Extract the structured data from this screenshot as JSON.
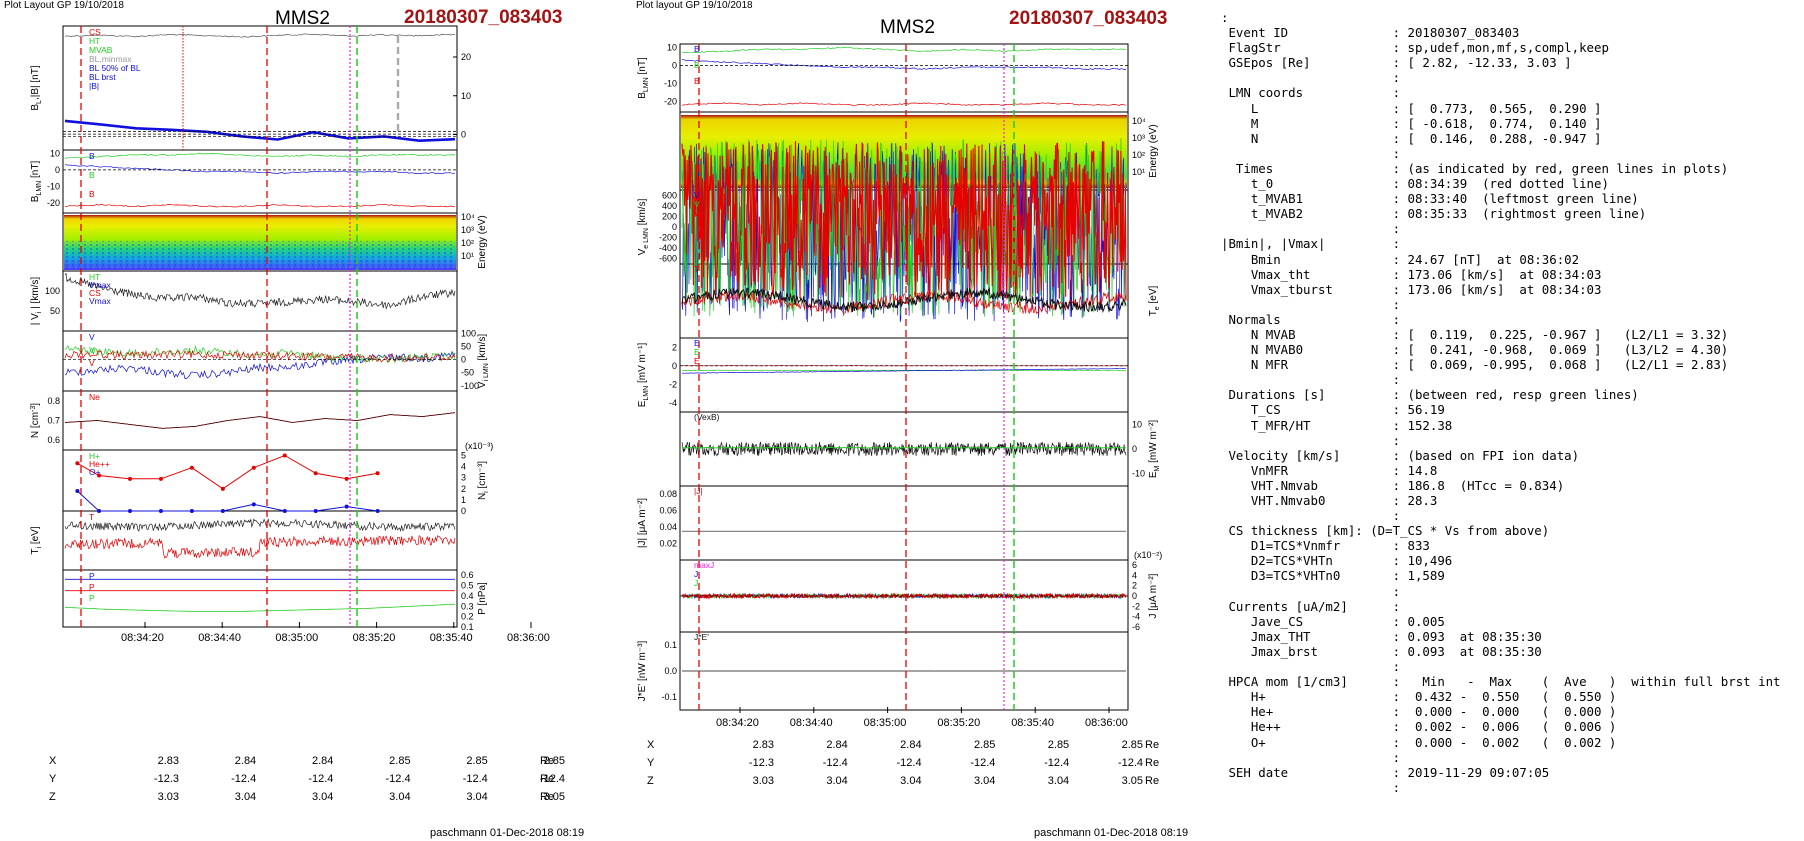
{
  "left_page": {
    "header": "Plot Layout GP 19/10/2018",
    "spacecraft": "MMS2",
    "event": "20180307_083403",
    "footer": "paschmann 01-Dec-2018 08:19",
    "panel_labels": [
      {
        "text": "B",
        "sub": "L",
        "tail": ",|B| [nT]"
      },
      {
        "text": "B",
        "sub": "LMN",
        "tail": " [nT]"
      },
      {
        "text": "Energy (eV)",
        "right": true
      },
      {
        "text": "| V",
        "sub": "i",
        "tail": " | [km/s]"
      },
      {
        "text": "V",
        "sub": "i LMN",
        "tail": " [km/s]",
        "right": true
      },
      {
        "text": "N [cm",
        "sup": "-3",
        "tail": "]"
      },
      {
        "text": "N",
        "sub": "i",
        "tail": " [cm⁻³]",
        "right": true
      },
      {
        "text": "T",
        "sub": "i",
        "tail": " [eV]"
      },
      {
        "text": "P [nPa]",
        "right": true
      }
    ],
    "legends": [
      [
        "CS",
        "HT",
        "MVAB",
        "BL,minmax",
        "BL 50% of BL",
        "BL brst",
        "|B|"
      ],
      [
        "B",
        "B",
        "B"
      ],
      [],
      [
        "HT",
        "Vmax",
        "CS",
        "Vmax"
      ],
      [
        "V",
        "V",
        "V"
      ],
      [
        "Ne"
      ],
      [
        "H+",
        "He++",
        "O+"
      ],
      [
        "T"
      ],
      [
        "P",
        "P",
        "P"
      ]
    ],
    "tick_labels": {
      "p0": [
        "20",
        "10",
        "0"
      ],
      "p1": [
        "10",
        "0",
        "-10",
        "-20"
      ],
      "p2": [
        "10⁴",
        "10³",
        "10²",
        "10¹"
      ],
      "p3": [
        "100",
        "50"
      ],
      "p4": [
        "100",
        "50",
        "0",
        "-50",
        "-100"
      ],
      "p5": [
        "0.8",
        "0.7",
        "0.6"
      ],
      "p6": [
        "5",
        "4",
        "3",
        "2",
        "1",
        "0"
      ],
      "p6_scale": "(x10⁻³)",
      "p8": [
        "0.6",
        "0.5",
        "0.4",
        "0.3",
        "0.2",
        "0.1"
      ]
    },
    "time_labels": [
      "08:34:20",
      "08:34:40",
      "08:35:00",
      "08:35:20",
      "08:35:40",
      "08:36:00"
    ],
    "position_rows": [
      {
        "name": "X",
        "values": [
          "2.83",
          "2.84",
          "2.84",
          "2.85",
          "2.85",
          "2.85"
        ],
        "unit": "Re"
      },
      {
        "name": "Y",
        "values": [
          "-12.3",
          "-12.4",
          "-12.4",
          "-12.4",
          "-12.4",
          "-12.4"
        ],
        "unit": "Re"
      },
      {
        "name": "Z",
        "values": [
          "3.03",
          "3.04",
          "3.04",
          "3.04",
          "3.04",
          "3.05"
        ],
        "unit": "Re"
      }
    ]
  },
  "right_page": {
    "header": "Plot layout GP 19/10/2018",
    "spacecraft": "MMS2",
    "event": "20180307_083403",
    "footer": "paschmann 01-Dec-2018 08:19",
    "panel_labels": [
      {
        "text": "B",
        "sub": "LMN",
        "tail": " [nT]"
      },
      {
        "text": "Energy (eV)",
        "right": true
      },
      {
        "text": "V",
        "sub": "e LMN",
        "tail": " [km/s]"
      },
      {
        "text": "T",
        "sub": "e",
        "tail": " [eV]",
        "right": true
      },
      {
        "text": "E",
        "sub": "LMN",
        "tail": " [mV m⁻¹]"
      },
      {
        "text": "E",
        "sub": "M",
        "tail": " [mW m⁻²]",
        "right": true
      },
      {
        "text": "|J| [μA m⁻²]"
      },
      {
        "text": "J [μA m⁻²]",
        "right": true
      },
      {
        "text": "J*E' [nW m⁻³]"
      }
    ],
    "legends": [
      [
        "B",
        "B",
        "B"
      ],
      [],
      [
        "V",
        "V",
        "V"
      ],
      [
        "T"
      ],
      [
        "E",
        "E",
        "E"
      ],
      [
        "(VexB)"
      ],
      [
        "|J|"
      ],
      [
        "maxJ",
        "J",
        "J"
      ],
      [
        "J*E'"
      ]
    ],
    "tick_labels": {
      "q0": [
        "10",
        "0",
        "-10",
        "-20"
      ],
      "q1": [
        "10⁴",
        "10³",
        "10²",
        "10¹"
      ],
      "q2": [
        "600",
        "400",
        "200",
        "0",
        "-200",
        "-400",
        "-600"
      ],
      "q4": [
        "2",
        "0",
        "-2",
        "-4"
      ],
      "q5": [
        "10",
        "0",
        "-10"
      ],
      "q6": [
        "0.08",
        "0.06",
        "0.04",
        "0.02"
      ],
      "q7": [
        "6",
        "4",
        "2",
        "0",
        "-2",
        "-4",
        "-6"
      ],
      "q7_scale": "(x10⁻²)",
      "q8": [
        "0.1",
        "0.0",
        "-0.1"
      ]
    },
    "time_labels": [
      "08:34:20",
      "08:34:40",
      "08:35:00",
      "08:35:20",
      "08:35:40",
      "08:36:00"
    ],
    "position_rows": [
      {
        "name": "X",
        "values": [
          "2.83",
          "2.84",
          "2.84",
          "2.85",
          "2.85",
          "2.85"
        ],
        "unit": "Re"
      },
      {
        "name": "Y",
        "values": [
          "-12.3",
          "-12.4",
          "-12.4",
          "-12.4",
          "-12.4",
          "-12.4"
        ],
        "unit": "Re"
      },
      {
        "name": "Z",
        "values": [
          "3.03",
          "3.04",
          "3.04",
          "3.04",
          "3.04",
          "3.05"
        ],
        "unit": "Re"
      }
    ]
  },
  "info_lines": [
    ":",
    " Event ID              : 20180307_083403",
    " FlagStr               : sp,udef,mon,mf,s,compl,keep",
    " GSEpos [Re]           : [ 2.82, -12.33, 3.03 ]",
    "                       :",
    " LMN coords            :",
    "    L                  : [  0.773,  0.565,  0.290 ]",
    "    M                  : [ -0.618,  0.774,  0.140 ]",
    "    N                  : [  0.146,  0.288, -0.947 ]",
    "                       :",
    "  Times                : (as indicated by red, green lines in plots)",
    "    t_0                : 08:34:39  (red dotted line)",
    "    t_MVAB1            : 08:33:40  (leftmost green line)",
    "    t_MVAB2            : 08:35:33  (rightmost green line)",
    "                       :",
    "|Bmin|, |Vmax|         :",
    "    Bmin               : 24.67 [nT]  at 08:36:02",
    "    Vmax_tht           : 173.06 [km/s]  at 08:34:03",
    "    Vmax_tburst        : 173.06 [km/s]  at 08:34:03",
    "                       :",
    " Normals               :",
    "    N MVAB             : [  0.119,  0.225, -0.967 ]   (L2/L1 = 3.32)",
    "    N MVAB0            : [  0.241, -0.968,  0.069 ]   (L3/L2 = 4.30)",
    "    N MFR              : [  0.069, -0.995,  0.068 ]   (L2/L1 = 2.83)",
    "                       :",
    " Durations [s]         : (between red, resp green lines)",
    "    T_CS               : 56.19",
    "    T_MFR/HT           : 152.38",
    "                       :",
    " Velocity [km/s]       : (based on FPI ion data)",
    "    VnMFR              : 14.8",
    "    VHT.Nmvab          : 186.8  (HTcc = 0.834)",
    "    VHT.Nmvab0         : 28.3",
    "                       :",
    " CS thickness [km]: (D=T_CS * Vs from above)",
    "    D1=TCS*Vnmfr       : 833",
    "    D2=TCS*VHTn        : 10,496",
    "    D3=TCS*VHTn0       : 1,589",
    "                       :",
    " Currents [uA/m2]      :",
    "    Jave_CS            : 0.005",
    "    Jmax_THT           : 0.093  at 08:35:30",
    "    Jmax_brst          : 0.093  at 08:35:30",
    "                       :",
    " HPCA mom [1/cm3]      :   Min   -  Max    (  Ave   )  within full brst int",
    "    H+                 :  0.432 -  0.550   (  0.550 )",
    "    He+                :  0.000 -  0.000   (  0.000 )",
    "    He++               :  0.002 -  0.006   (  0.006 )",
    "    O+                 :  0.000 -  0.002   (  0.002 )",
    "                       :",
    " SEH date              : 2019-11-29 09:07:05",
    "                       :"
  ],
  "colors": {
    "event": "#a21414",
    "red": "#e60000",
    "green": "#22cc22",
    "blue": "#1010dd",
    "black": "#000000",
    "magenta": "#ee22ee",
    "grey": "#999999"
  },
  "chart_data": [
    {
      "type": "line",
      "title": "MMS2 20180307_083403",
      "x_ticks": [
        "08:34:20",
        "08:34:40",
        "08:35:00",
        "08:35:20",
        "08:35:40",
        "08:36:00"
      ],
      "markers": {
        "red_dashed": "08:34:03",
        "red_dotted": "08:34:39",
        "green_dashed": "08:35:33",
        "magenta_dotted": "08:35:30"
      },
      "panels": [
        {
          "ylabel": "BL,|B| [nT]",
          "ylim": [
            -4,
            28
          ],
          "series": [
            {
              "name": "|B|",
              "values": [
                25.4,
                25.6,
                25.3,
                25.8,
                25.5,
                25.2,
                25.6,
                25.9,
                25.4,
                25.7,
                25.5,
                25.8
              ]
            },
            {
              "name": "BL brst",
              "values": [
                3.5,
                2.6,
                1.6,
                1.2,
                0.7,
                -0.5,
                -1.3,
                0.6,
                -1.0,
                -0.5,
                -1.6,
                -1.2
              ]
            }
          ]
        },
        {
          "ylabel": "BLMN [nT]",
          "ylim": [
            -26,
            12
          ],
          "series": [
            {
              "name": "BL",
              "values": [
                3,
                2,
                1,
                0,
                -1,
                -1,
                -2,
                -1,
                -1,
                -1,
                -2,
                -2
              ]
            },
            {
              "name": "BM",
              "values": [
                7,
                8,
                9,
                9,
                10,
                9,
                8,
                9,
                8,
                9,
                9,
                9
              ]
            },
            {
              "name": "BN",
              "values": [
                -22,
                -21,
                -22,
                -21,
                -22,
                -22,
                -21,
                -22,
                -22,
                -21,
                -22,
                -22
              ]
            }
          ]
        },
        {
          "ylabel": "|Vi| [km/s]",
          "ylim": [
            0,
            150
          ],
          "series": [
            {
              "name": "Vi",
              "values": [
                135,
                110,
                92,
                80,
                86,
                70,
                68,
                74,
                80,
                72,
                64,
                86,
                96
              ]
            }
          ]
        },
        {
          "ylabel": "Vi LMN [km/s]",
          "ylim": [
            -120,
            110
          ],
          "series": [
            {
              "name": "VL",
              "values": [
                -50,
                -40,
                -30,
                -50,
                -62,
                -50,
                -30,
                -28,
                -10,
                0,
                10,
                5,
                20
              ]
            },
            {
              "name": "VM",
              "values": [
                42,
                30,
                22,
                30,
                36,
                25,
                20,
                24,
                10,
                6,
                0,
                10,
                12
              ]
            },
            {
              "name": "VN",
              "values": [
                20,
                22,
                16,
                20,
                18,
                20,
                16,
                14,
                10,
                8,
                6,
                8,
                10
              ]
            }
          ]
        },
        {
          "ylabel": "N [cm-3]",
          "ylim": [
            0.55,
            0.85
          ],
          "series": [
            {
              "name": "Ne",
              "values": [
                0.69,
                0.7,
                0.68,
                0.66,
                0.67,
                0.7,
                0.72,
                0.69,
                0.71,
                0.7,
                0.73,
                0.72,
                0.74
              ]
            }
          ]
        },
        {
          "ylabel": "Ni [cm-3] (x10^-3)",
          "ylim": [
            0,
            5.5
          ],
          "x": [
            "08:34:07",
            "08:34:14",
            "08:34:24",
            "08:34:34",
            "08:34:44",
            "08:34:54",
            "08:35:04",
            "08:35:14",
            "08:35:24",
            "08:35:34",
            "08:35:44"
          ],
          "series": [
            {
              "name": "He++",
              "values": [
                4.3,
                3.2,
                2.9,
                2.9,
                3.9,
                2.0,
                3.9,
                5.0,
                3.4,
                2.9,
                3.4
              ]
            },
            {
              "name": "O+",
              "values": [
                1.8,
                0.0,
                0.0,
                0.0,
                0.0,
                0.0,
                0.6,
                0.0,
                0.0,
                0.4,
                0.0
              ]
            }
          ]
        },
        {
          "ylabel": "Ti [eV]",
          "series": []
        },
        {
          "ylabel": "P [nPa]",
          "ylim": [
            0.1,
            0.65
          ],
          "series": [
            {
              "name": "P blue",
              "values": [
                0.56,
                0.56,
                0.56,
                0.56,
                0.56,
                0.56,
                0.56,
                0.56,
                0.56,
                0.56
              ]
            },
            {
              "name": "P red",
              "values": [
                0.45,
                0.45,
                0.45,
                0.45,
                0.45,
                0.45,
                0.45,
                0.45,
                0.45,
                0.45
              ]
            },
            {
              "name": "P green",
              "values": [
                0.29,
                0.27,
                0.26,
                0.25,
                0.25,
                0.26,
                0.27,
                0.28,
                0.3,
                0.32
              ]
            }
          ]
        }
      ]
    },
    {
      "type": "line",
      "title": "MMS2 20180307_083403",
      "x_ticks": [
        "08:34:20",
        "08:34:40",
        "08:35:00",
        "08:35:20",
        "08:35:40",
        "08:36:00"
      ],
      "panels": [
        {
          "ylabel": "BLMN [nT]",
          "ylim": [
            -26,
            12
          ]
        },
        {
          "ylabel": "Ve LMN [km/s]",
          "ylim": [
            -700,
            700
          ]
        },
        {
          "ylabel": "ELMN [mV m-1]",
          "ylim": [
            -5,
            3
          ]
        },
        {
          "ylabel": "EM [mW m-2]",
          "ylim": [
            -15,
            15
          ]
        },
        {
          "ylabel": "|J| [μA m-2]",
          "ylim": [
            0,
            0.09
          ]
        },
        {
          "ylabel": "J [μA m-2] (x10^-2)",
          "ylim": [
            -7,
            7
          ]
        },
        {
          "ylabel": "J*E' [nW m-3]",
          "ylim": [
            -0.15,
            0.15
          ]
        }
      ]
    }
  ]
}
